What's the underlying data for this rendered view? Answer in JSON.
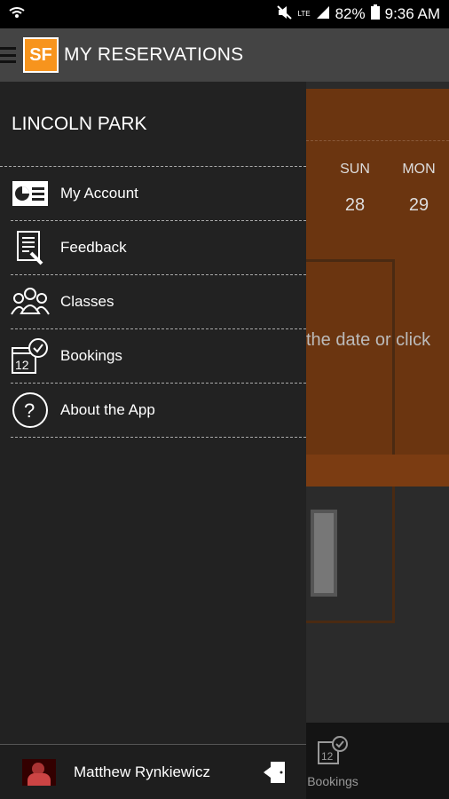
{
  "status_bar": {
    "network": "LTE",
    "battery": "82%",
    "time": "9:36 AM"
  },
  "app_bar": {
    "logo_text": "SF",
    "title": "MY RESERVATIONS"
  },
  "background": {
    "days": [
      "SUN",
      "MON"
    ],
    "dates": [
      "28",
      "29"
    ],
    "hint_text": "the date or click",
    "bottom_tab_label": "Bookings"
  },
  "drawer": {
    "header": "LINCOLN PARK",
    "items": [
      {
        "label": "My Account",
        "icon": "account-card-icon"
      },
      {
        "label": "Feedback",
        "icon": "feedback-form-icon"
      },
      {
        "label": "Classes",
        "icon": "group-people-icon"
      },
      {
        "label": "Bookings",
        "icon": "calendar-clock-icon"
      },
      {
        "label": "About the App",
        "icon": "question-circle-icon"
      }
    ],
    "user_name": "Matthew Rynkiewicz"
  },
  "colors": {
    "accent": "#f7941d",
    "drawer_bg": "#222222",
    "app_bar_bg": "#444444"
  }
}
